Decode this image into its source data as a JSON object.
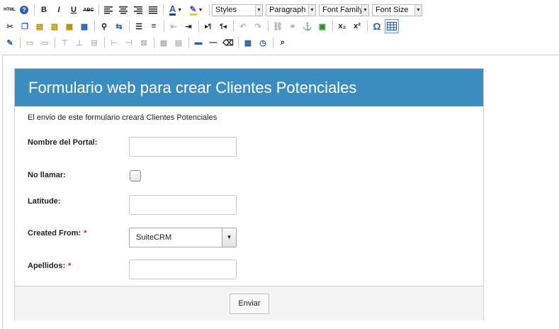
{
  "toolbar": {
    "html_label": "HTML",
    "help_glyph": "?",
    "bold": "B",
    "italic": "I",
    "underline": "U",
    "strike": "ABC",
    "font_color": "A",
    "styles_select": "Styles",
    "format_select": "Paragraph",
    "font_family_select": "Font Family",
    "font_size_select": "Font Size",
    "subscript": "x₂",
    "superscript": "x²",
    "omega": "Ω"
  },
  "form": {
    "title": "Formulario web para crear Clientes Potenciales",
    "description": "El envio de este formulario creará Clientes Potenciales",
    "fields": {
      "portal_name": {
        "label": "Nombre del Portal:",
        "value": ""
      },
      "no_call": {
        "label": "No llamar:",
        "checked": false
      },
      "latitude": {
        "label": "Latitude:",
        "value": ""
      },
      "created_from": {
        "label": "Created From:",
        "required_mark": "*",
        "selected": "SuiteCRM"
      },
      "last_name": {
        "label": "Apellidos:",
        "required_mark": "*",
        "value": ""
      }
    },
    "submit_label": "Enviar"
  },
  "colors": {
    "header_bg": "#3c8dbf",
    "required": "#d21d1d",
    "footer_bg": "#f4f4f4"
  }
}
